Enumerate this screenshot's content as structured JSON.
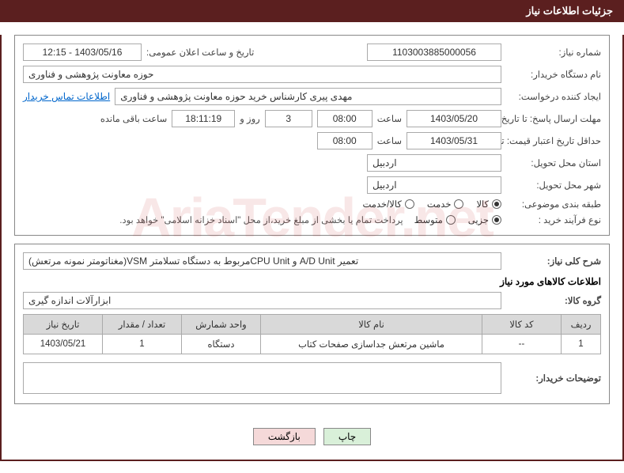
{
  "watermark": "AriaTender.net",
  "header": {
    "title": "جزئیات اطلاعات نیاز"
  },
  "fields": {
    "need_number_lbl": "شماره نیاز:",
    "need_number": "1103003885000056",
    "announce_dt_lbl": "تاریخ و ساعت اعلان عمومی:",
    "announce_dt": "1403/05/16 - 12:15",
    "buyer_org_lbl": "نام دستگاه خریدار:",
    "buyer_org": "حوزه معاونت پژوهشی و فناوری",
    "requester_lbl": "ایجاد کننده درخواست:",
    "requester": "مهدی پیری کارشناس خرید حوزه معاونت پژوهشی و فناوری",
    "buyer_contact_link": "اطلاعات تماس خریدار",
    "reply_deadline_lbl": "مهلت ارسال پاسخ: تا تاریخ:",
    "reply_date": "1403/05/20",
    "time_lbl": "ساعت",
    "reply_time": "08:00",
    "days_remaining": "3",
    "days_and_lbl": "روز و",
    "countdown": "18:11:19",
    "hours_remaining_lbl": "ساعت باقی مانده",
    "price_valid_lbl": "حداقل تاریخ اعتبار قیمت: تا تاریخ:",
    "price_valid_date": "1403/05/31",
    "price_valid_time": "08:00",
    "delivery_province_lbl": "استان محل تحویل:",
    "delivery_province": "اردبیل",
    "delivery_city_lbl": "شهر محل تحویل:",
    "delivery_city": "اردبیل",
    "subject_class_lbl": "طبقه بندی موضوعی:",
    "subject_class_options": {
      "goods": "کالا",
      "service": "خدمت",
      "goods_service": "کالا/خدمت"
    },
    "purchase_proc_lbl": "نوع فرآیند خرید :",
    "purchase_proc_options": {
      "partial": "جزیی",
      "medium": "متوسط"
    },
    "payment_note": "پرداخت تمام یا بخشی از مبلغ خرید،از محل \"اسناد خزانه اسلامی\" خواهد بود.",
    "need_desc_lbl": "شرح کلی نیاز:",
    "need_desc": "تعمیر A/D Unit و CPU Unitمربوط به دستگاه تسلامتر VSM(مغناتومتر نمونه مرتعش)",
    "goods_info_title": "اطلاعات کالاهای مورد نیاز",
    "goods_group_lbl": "گروه کالا:",
    "goods_group": "ابزارآلات اندازه گیری"
  },
  "table": {
    "headers": {
      "row": "ردیف",
      "code": "کد کالا",
      "name": "نام کالا",
      "unit": "واحد شمارش",
      "qty": "تعداد / مقدار",
      "date": "تاریخ نیاز"
    },
    "rows": [
      {
        "row": "1",
        "code": "--",
        "name": "ماشین مرتعش جداسازی صفحات کتاب",
        "unit": "دستگاه",
        "qty": "1",
        "date": "1403/05/21"
      }
    ]
  },
  "buyer_notes_lbl": "توضیحات خریدار:",
  "buttons": {
    "print": "چاپ",
    "back": "بازگشت"
  }
}
